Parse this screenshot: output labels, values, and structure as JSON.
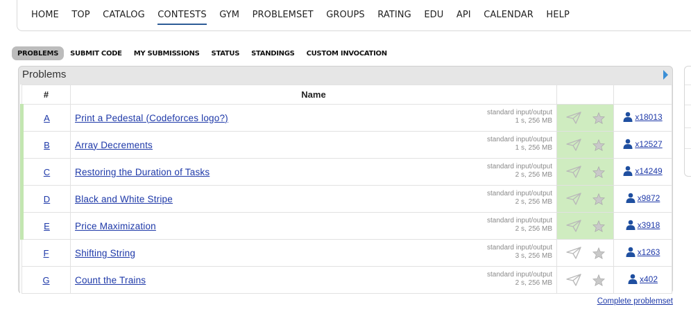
{
  "nav": {
    "items": [
      {
        "label": "HOME"
      },
      {
        "label": "TOP"
      },
      {
        "label": "CATALOG"
      },
      {
        "label": "CONTESTS"
      },
      {
        "label": "GYM"
      },
      {
        "label": "PROBLEMSET"
      },
      {
        "label": "GROUPS"
      },
      {
        "label": "RATING"
      },
      {
        "label": "EDU"
      },
      {
        "label": "API"
      },
      {
        "label": "CALENDAR"
      },
      {
        "label": "HELP"
      }
    ],
    "current": "CONTESTS"
  },
  "submenu": {
    "items": [
      {
        "label": "PROBLEMS"
      },
      {
        "label": "SUBMIT CODE"
      },
      {
        "label": "MY SUBMISSIONS"
      },
      {
        "label": "STATUS"
      },
      {
        "label": "STANDINGS"
      },
      {
        "label": "CUSTOM INVOCATION"
      }
    ],
    "active": "PROBLEMS"
  },
  "problems_box": {
    "title": "Problems",
    "columns": {
      "id": "#",
      "name": "Name"
    },
    "rows": [
      {
        "id": "A",
        "name": "Print a Pedestal (Codeforces logo?)",
        "io": "standard input/output",
        "limits": "1 s, 256 MB",
        "count": "x18013",
        "accepted": true
      },
      {
        "id": "B",
        "name": "Array Decrements",
        "io": "standard input/output",
        "limits": "1 s, 256 MB",
        "count": "x12527",
        "accepted": true
      },
      {
        "id": "C",
        "name": "Restoring the Duration of Tasks",
        "io": "standard input/output",
        "limits": "2 s, 256 MB",
        "count": "x14249",
        "accepted": true
      },
      {
        "id": "D",
        "name": "Black and White Stripe",
        "io": "standard input/output",
        "limits": "2 s, 256 MB",
        "count": "x9872",
        "accepted": true
      },
      {
        "id": "E",
        "name": "Price Maximization",
        "io": "standard input/output",
        "limits": "2 s, 256 MB",
        "count": "x3918",
        "accepted": true
      },
      {
        "id": "F",
        "name": "Shifting String",
        "io": "standard input/output",
        "limits": "3 s, 256 MB",
        "count": "x1263",
        "accepted": false
      },
      {
        "id": "G",
        "name": "Count the Trains",
        "io": "standard input/output",
        "limits": "2 s, 256 MB",
        "count": "x402",
        "accepted": false
      }
    ],
    "complete_link": "Complete problemset"
  },
  "icons": {
    "submit": "paper-plane-icon",
    "favourite": "star-icon",
    "solved_count": "user-icon",
    "next": "arrow-right-icon"
  },
  "colors": {
    "link": "#1d38a8",
    "accepted_bg": "#cfecc0",
    "accepted_edge": "#c3e6b1",
    "nav_underline": "#2c5b96",
    "user_icon": "#1f4fa0"
  }
}
